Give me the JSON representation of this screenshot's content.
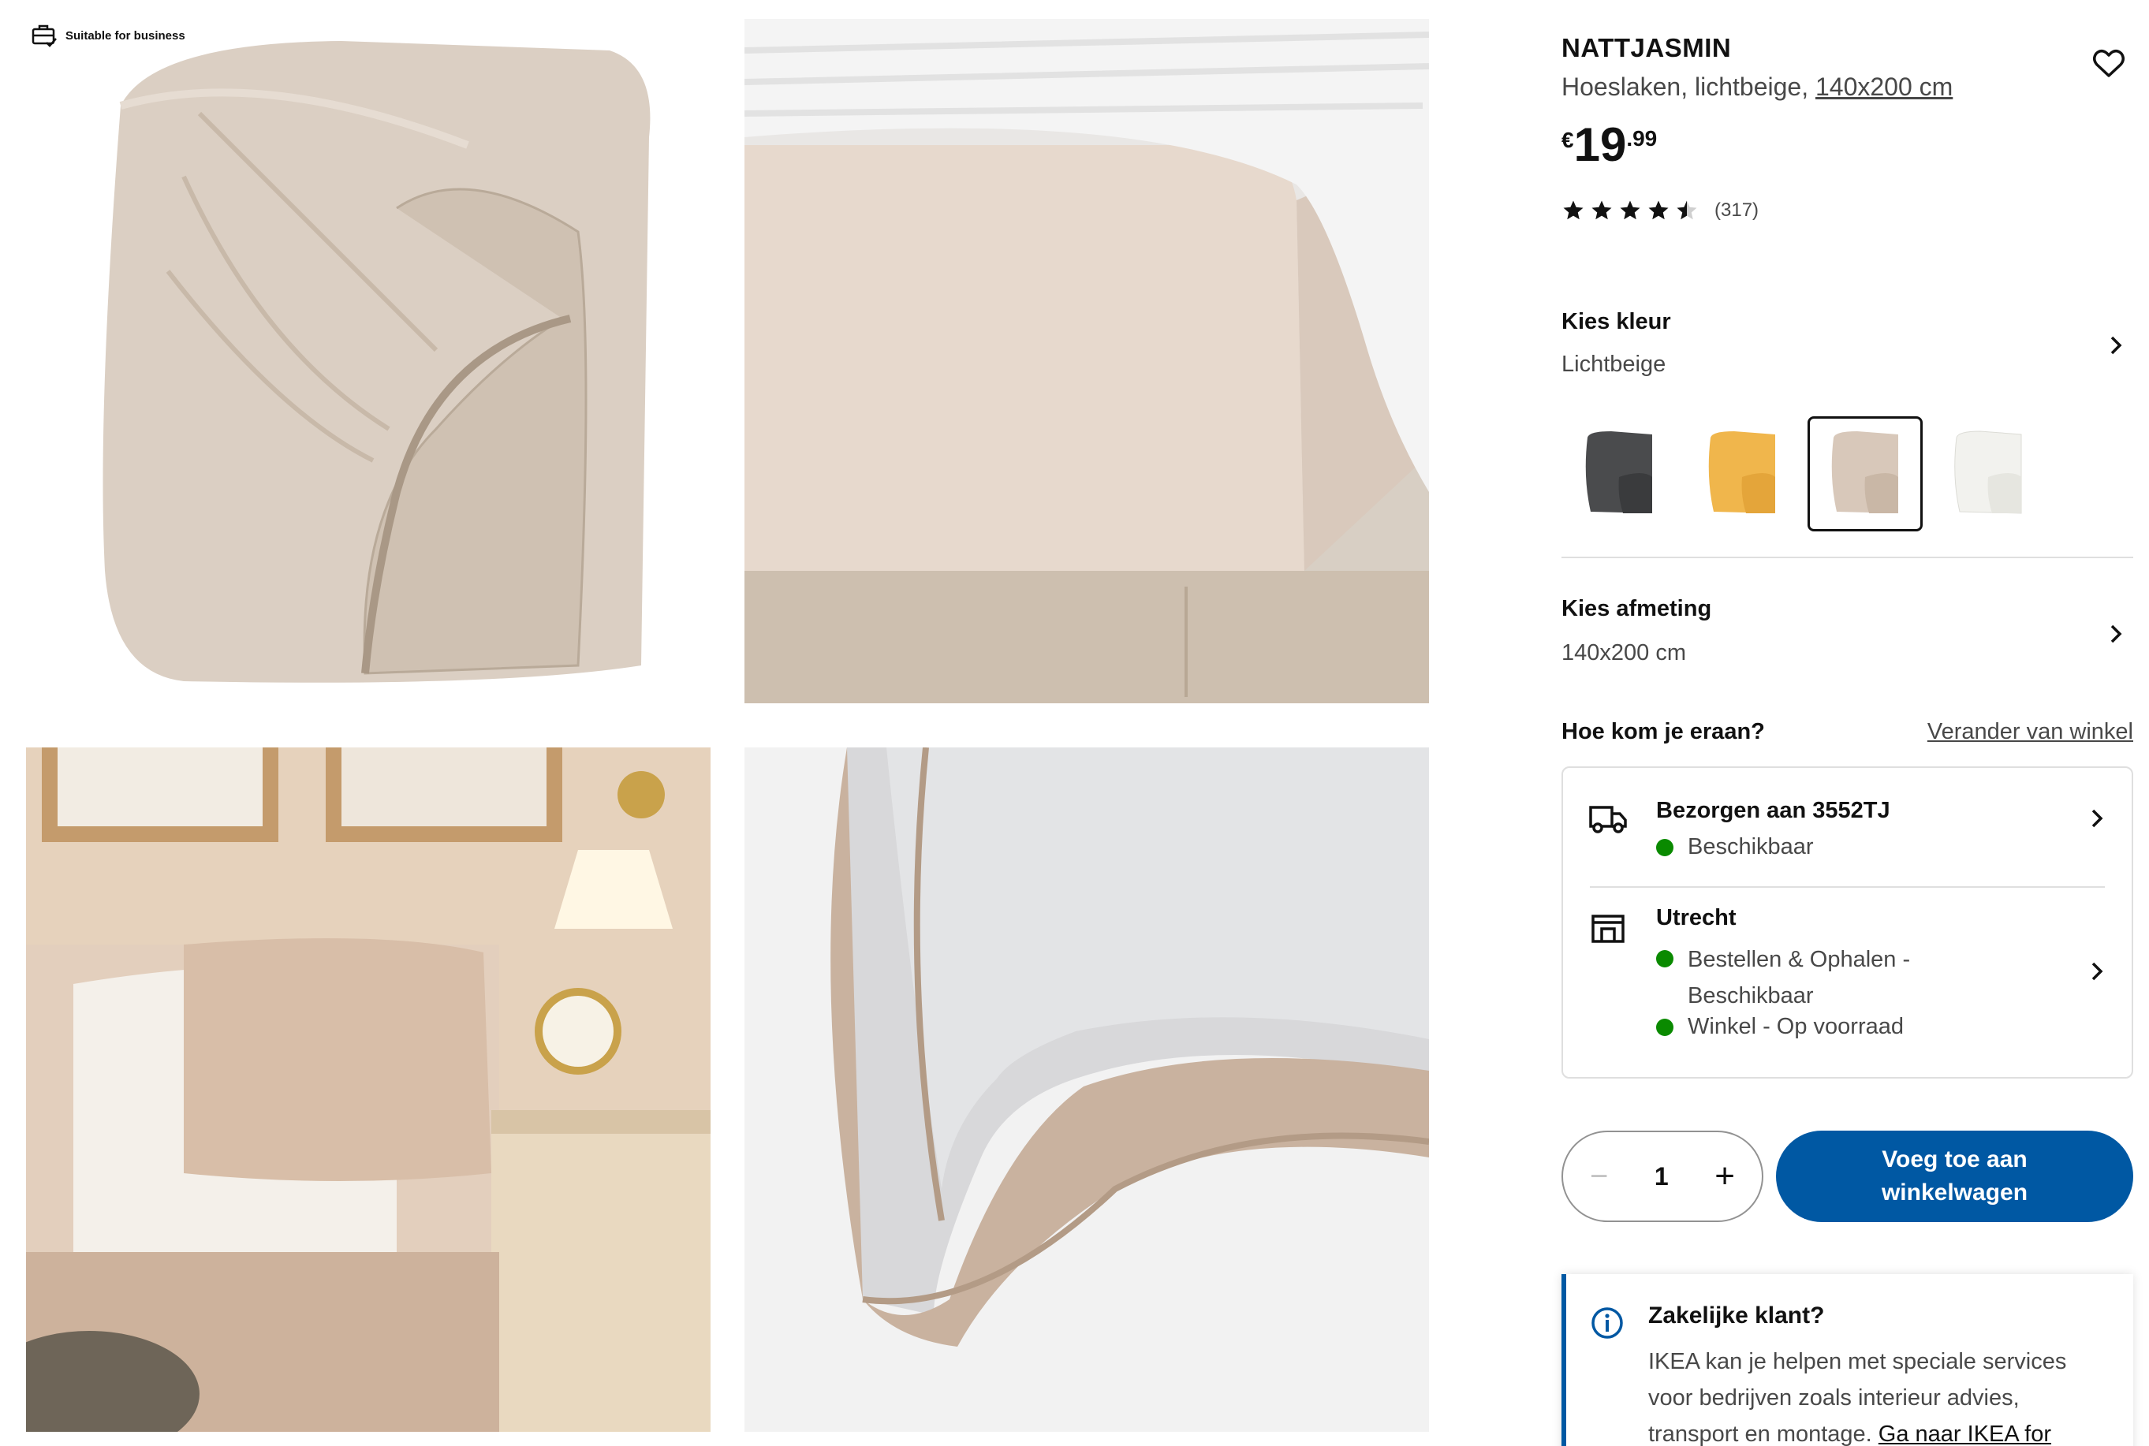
{
  "badge": {
    "label": "Suitable for business",
    "icon": "briefcase-check-icon"
  },
  "gallery": {
    "images": [
      {
        "name": "fitted-sheet-product-photo",
        "alt": "fitted sheet folded"
      },
      {
        "name": "bed-corner-photo",
        "alt": "mattress with sheet"
      },
      {
        "name": "bedroom-scene-photo",
        "alt": "bedroom with pillows and lamp"
      },
      {
        "name": "sheet-corner-detail-photo",
        "alt": "elastic corner detail"
      }
    ]
  },
  "product": {
    "name": "NATTJASMIN",
    "desc_prefix": "Hoeslaken, lichtbeige, ",
    "desc_size": "140x200 cm",
    "price": {
      "currency": "€",
      "integer": "19",
      "decimal": ".99"
    },
    "rating": {
      "value": 4.5,
      "max": 5,
      "count": "(317)"
    },
    "favourite_icon": "heart-outline-icon"
  },
  "color": {
    "label": "Kies kleur",
    "value": "Lichtbeige",
    "swatches": [
      {
        "name": "dark-grey",
        "color": "#4a4b4d"
      },
      {
        "name": "yellow",
        "color": "#f0b64c"
      },
      {
        "name": "light-beige",
        "color": "#d8c8ba",
        "selected": true
      },
      {
        "name": "white",
        "color": "#f2f2ee"
      }
    ]
  },
  "size": {
    "label": "Kies afmeting",
    "value": "140x200 cm"
  },
  "availability": {
    "heading": "Hoe kom je eraan?",
    "change_store": "Verander van winkel",
    "delivery": {
      "title": "Bezorgen aan 3552TJ",
      "status": "Beschikbaar",
      "icon": "truck-icon"
    },
    "store": {
      "title": "Utrecht",
      "status1_line1": "Bestellen & Ophalen -",
      "status1_line2": "Beschikbaar",
      "status2": "Winkel - Op voorraad",
      "icon": "store-icon"
    },
    "status_color": "#0a8a00"
  },
  "cart": {
    "quantity": "1",
    "minus": "−",
    "plus": "+",
    "add_line1": "Voeg toe aan",
    "add_line2": "winkelwagen",
    "button_color": "#0058a3"
  },
  "business": {
    "title": "Zakelijke klant?",
    "text": "IKEA kan je helpen met speciale services voor bedrijven zoals interieur advies, transport en montage. ",
    "link": "Ga naar IKEA for",
    "icon": "info-icon"
  }
}
